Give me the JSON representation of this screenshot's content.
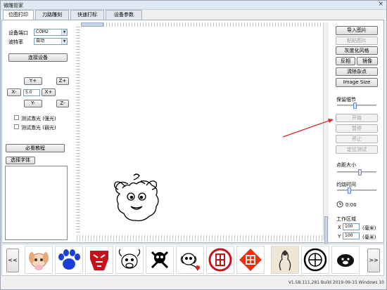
{
  "window": {
    "title": "微雕管家",
    "close_glyph": "×"
  },
  "tabs": [
    {
      "label": "位图打印",
      "active": true
    },
    {
      "label": "刀路雕刻",
      "active": false
    },
    {
      "label": "快速打标",
      "active": false
    },
    {
      "label": "设备参数",
      "active": false
    }
  ],
  "left": {
    "port_label": "设备端口",
    "port_value": "COM2",
    "baud_label": "波特率",
    "baud_value": "自动",
    "connect_button": "连接设备",
    "y_plus": "Y+",
    "z_plus": "Z+",
    "x_minus": "X-",
    "step_value": "5.0",
    "x_plus": "X+",
    "y_minus": "Y-",
    "z_minus": "Z-",
    "test_strong": "测试激光 (强光)",
    "test_weak": "测试激光 (弱光)",
    "tutorial_button": "必看教程",
    "font_button": "选择字体"
  },
  "right": {
    "import_button": "导入图片",
    "paste_button": "粘贴图片",
    "gray_button": "灰度化风格",
    "invert_button": "反相",
    "mirror_button": "镜像",
    "denoise_button": "清除杂点",
    "image_size_button": "Image Size",
    "detail_label": "保留细节",
    "detail_level": 0.45,
    "start_button": "开始",
    "pause_button": "暂停",
    "stop_button": "停止",
    "locate_button": "定位测试",
    "point_size_label": "点距大小",
    "point_size_level": 0.6,
    "burn_time_label": "灼烧时间",
    "burn_time_level": 0.3,
    "time_value": "0:00",
    "work_area_label": "工作区域",
    "x_label": "X",
    "x_value": "100",
    "y_label": "Y",
    "y_value": "100",
    "unit": "(毫米)"
  },
  "gallery": {
    "prev": "<<",
    "next": ">>",
    "items": [
      {
        "name": "puppy"
      },
      {
        "name": "paw"
      },
      {
        "name": "robot-logo"
      },
      {
        "name": "cow"
      },
      {
        "name": "skull"
      },
      {
        "name": "dog"
      },
      {
        "name": "fu-seal"
      },
      {
        "name": "fu-diamond"
      },
      {
        "name": "figure"
      },
      {
        "name": "emblem"
      },
      {
        "name": "pig"
      }
    ]
  },
  "status": "V1.58.111.281 Build 2019-09-15 Windows 10"
}
